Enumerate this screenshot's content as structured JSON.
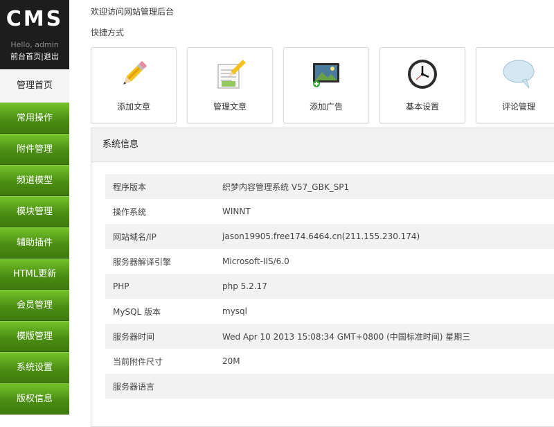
{
  "sidebar": {
    "logo": "CMS",
    "hello": "Hello, admin",
    "link_front": "前台首页",
    "link_sep": "|",
    "link_logout": "退出",
    "home": "管理首页",
    "items": [
      {
        "label": "常用操作"
      },
      {
        "label": "附件管理"
      },
      {
        "label": "频道模型"
      },
      {
        "label": "模块管理"
      },
      {
        "label": "辅助插件"
      },
      {
        "label": "HTML更新"
      },
      {
        "label": "会员管理"
      },
      {
        "label": "模版管理"
      },
      {
        "label": "系统设置"
      },
      {
        "label": "版权信息"
      }
    ]
  },
  "main": {
    "welcome": "欢迎访问网站管理后台",
    "shortcut_title": "快捷方式",
    "shortcuts": [
      {
        "label": "添加文章",
        "icon": "pencil-icon"
      },
      {
        "label": "管理文章",
        "icon": "edit-document-icon"
      },
      {
        "label": "添加广告",
        "icon": "monitor-image-icon"
      },
      {
        "label": "基本设置",
        "icon": "clock-icon"
      },
      {
        "label": "评论管理",
        "icon": "speech-bubble-icon"
      }
    ],
    "sys_title": "系统信息",
    "sys_rows": [
      {
        "key": "程序版本",
        "value": "织梦内容管理系统 V57_GBK_SP1"
      },
      {
        "key": "操作系统",
        "value": "WINNT"
      },
      {
        "key": "网站域名/IP",
        "value": "jason19905.free174.6464.cn(211.155.230.174)"
      },
      {
        "key": "服务器解译引擎",
        "value": "Microsoft-IIS/6.0"
      },
      {
        "key": "PHP",
        "value": "php 5.2.17"
      },
      {
        "key": "MySQL 版本",
        "value": "mysql"
      },
      {
        "key": "服务器时间",
        "value": "Wed Apr 10 2013 15:08:34 GMT+0800 (中国标准时间) 星期三"
      },
      {
        "key": "当前附件尺寸",
        "value": "20M"
      },
      {
        "key": "服务器语言",
        "value": ""
      }
    ]
  },
  "colors": {
    "menu_green": "#4b8e13",
    "brand_dark": "#1d1d1d"
  }
}
